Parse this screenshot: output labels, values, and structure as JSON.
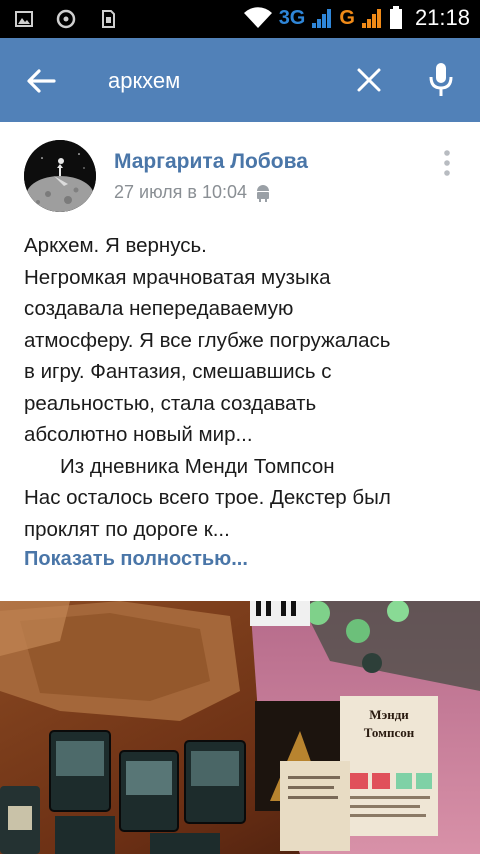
{
  "status_bar": {
    "network_1": "3G",
    "network_2": "G",
    "time": "21:18"
  },
  "search": {
    "query": "аркхем"
  },
  "post": {
    "author": "Маргарита Лобова",
    "date": "27 июля в 10:04",
    "text_lines": [
      "Аркхем. Я вернусь.",
      "Негромкая мрачноватая музыка",
      "создавала непередаваемую",
      "атмосферу. Я все глубже погружалась",
      "в игру. Фантазия, смешавшись с",
      "реальностью, стала создавать",
      "абсолютно новый мир...",
      "Из дневника Менди Томпсон",
      "Нас осталось всего трое. Декстер был",
      "проклят по дороге к..."
    ],
    "show_more": "Показать полностью...",
    "photo": {
      "card_title_1": "Мэнди",
      "card_title_2": "Томпсон"
    }
  },
  "colors": {
    "app_bar": "#5181b8",
    "link": "#4a76a8",
    "meta": "#8a8f94"
  }
}
